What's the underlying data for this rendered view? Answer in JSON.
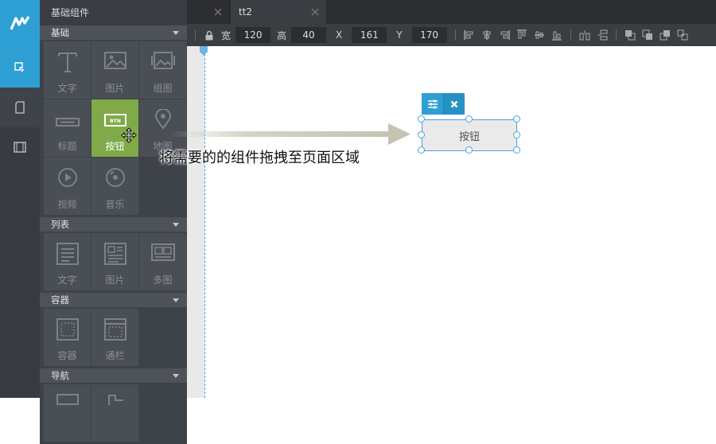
{
  "panel": {
    "title": "基础组件",
    "sections": [
      {
        "label": "基础",
        "items": [
          "文字",
          "图片",
          "组图",
          "标题",
          "按钮",
          "地图",
          "视频",
          "音乐"
        ]
      },
      {
        "label": "列表",
        "items": [
          "文字",
          "图片",
          "多图"
        ]
      },
      {
        "label": "容器",
        "items": [
          "容器",
          "通栏"
        ]
      },
      {
        "label": "导航",
        "items": []
      }
    ]
  },
  "tabs": [
    {
      "label": ""
    },
    {
      "label": "tt2"
    }
  ],
  "toolbar": {
    "width_label": "宽",
    "width_value": "120",
    "height_label": "高",
    "height_value": "40",
    "x_label": "X",
    "x_value": "161",
    "y_label": "Y",
    "y_value": "170"
  },
  "canvas": {
    "button_label": "按钮"
  },
  "annotation": {
    "text": "将需要的的组件拖拽至页面区域"
  },
  "colors": {
    "accent": "#2e9fd3",
    "active_tile": "#80aa49",
    "panel_bg": "#3e4249",
    "rail_bg": "#383c42"
  }
}
